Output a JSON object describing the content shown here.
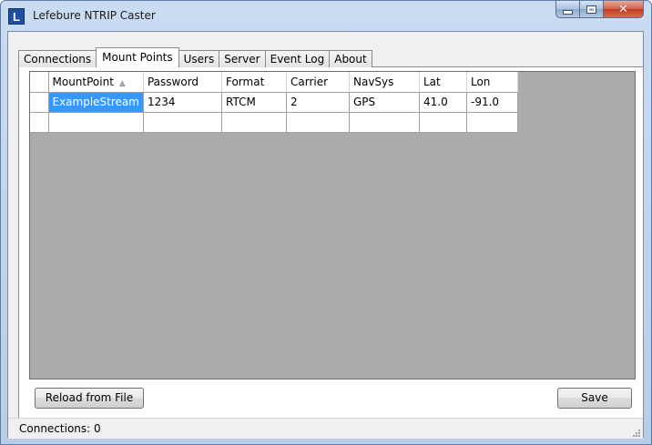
{
  "window": {
    "title": "Lefebure NTRIP Caster",
    "icon_letter": "L",
    "controls": {
      "minimize": "minimize-icon",
      "maximize": "maximize-icon",
      "close": "close-icon"
    }
  },
  "tabs": [
    {
      "label": "Connections",
      "active": false
    },
    {
      "label": "Mount Points",
      "active": true
    },
    {
      "label": "Users",
      "active": false
    },
    {
      "label": "Server",
      "active": false
    },
    {
      "label": "Event Log",
      "active": false
    },
    {
      "label": "About",
      "active": false
    }
  ],
  "grid": {
    "columns": [
      "MountPoint",
      "Password",
      "Format",
      "Carrier",
      "NavSys",
      "Lat",
      "Lon"
    ],
    "sort_column": "MountPoint",
    "sort_direction": "ascending",
    "rows": [
      [
        "ExampleStream",
        "1234",
        "RTCM",
        "2",
        "GPS",
        "41.0",
        "-91.0"
      ],
      [
        "",
        "",
        "",
        "",
        "",
        "",
        ""
      ]
    ]
  },
  "buttons": {
    "reload": "Reload from File",
    "save": "Save"
  },
  "status": {
    "text": "Connections: 0"
  },
  "colors": {
    "selection": "#3399ff",
    "grid_background": "#ababab"
  }
}
